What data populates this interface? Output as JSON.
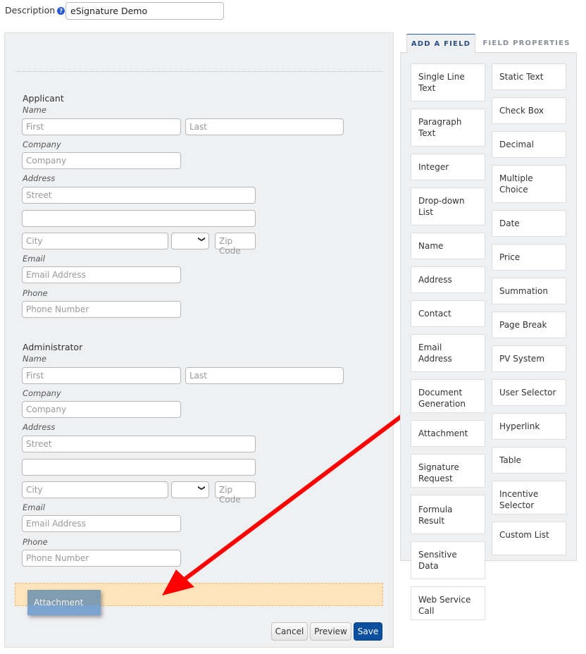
{
  "description": {
    "label": "Description",
    "help_icon": "help-circle-icon",
    "value": "eSignature Demo"
  },
  "sections": [
    {
      "title": "Applicant",
      "name_label": "Name",
      "first_ph": "First",
      "last_ph": "Last",
      "company_label": "Company",
      "company_ph": "Company",
      "address_label": "Address",
      "street_ph": "Street",
      "city_ph": "City",
      "zip_ph": "Zip Code",
      "email_label": "Email",
      "email_ph": "Email Address",
      "phone_label": "Phone",
      "phone_ph": "Phone Number"
    },
    {
      "title": "Administrator",
      "name_label": "Name",
      "first_ph": "First",
      "last_ph": "Last",
      "company_label": "Company",
      "company_ph": "Company",
      "address_label": "Address",
      "street_ph": "Street",
      "city_ph": "City",
      "zip_ph": "Zip Code",
      "email_label": "Email",
      "email_ph": "Email Address",
      "phone_label": "Phone",
      "phone_ph": "Phone Number"
    }
  ],
  "drag": {
    "label": "Attachment",
    "arrow_color": "#ff0000"
  },
  "buttons": {
    "cancel": "Cancel",
    "preview": "Preview",
    "save": "Save"
  },
  "tabs": {
    "add": "ADD A FIELD",
    "props": "FIELD PROPERTIES",
    "active": "ADD A FIELD"
  },
  "fields_left": [
    "Single Line Text",
    "Paragraph Text",
    "Integer",
    "Drop-down List",
    "Name",
    "Address",
    "Contact",
    "Email Address",
    "Document Generation",
    "Attachment",
    "Signature Request",
    "Formula Result",
    "Sensitive Data",
    "Web Service Call"
  ],
  "fields_right": [
    "Static Text",
    "Check Box",
    "Decimal",
    "Multiple Choice",
    "Date",
    "Price",
    "Summation",
    "Page Break",
    "PV System",
    "User Selector",
    "Hyperlink",
    "Table",
    "Incentive Selector",
    "Custom List"
  ],
  "colors": {
    "accent": "#0c4f9e",
    "drop_zone": "#fde4bc"
  }
}
